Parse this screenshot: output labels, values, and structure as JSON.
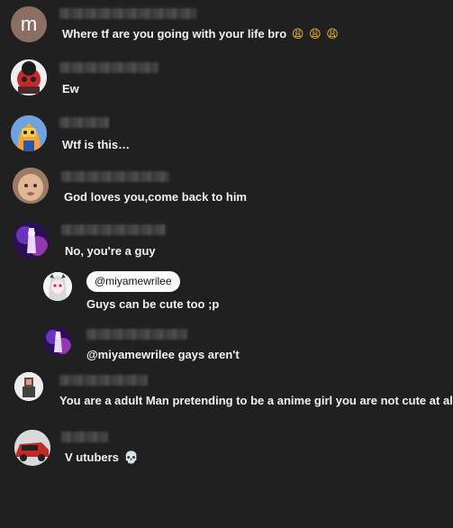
{
  "comments": [
    {
      "avatar_letter": "m",
      "avatar_color": "#8d6e63",
      "text": "Where tf are you going with your life bro",
      "emojis": [
        "😩",
        "😩",
        "😩"
      ]
    },
    {
      "text": "Ew"
    },
    {
      "text": "Wtf is this…"
    },
    {
      "text": "God loves you,come back to him"
    },
    {
      "text": "No, you're a guy",
      "replies": [
        {
          "mention": "@miyamewrilee",
          "text": "Guys can be cute too ;p"
        },
        {
          "text": "@miyamewrilee gays aren't"
        }
      ]
    },
    {
      "text": "You are a adult Man pretending to be a anime girl you are not cute at all"
    },
    {
      "text": "V utubers",
      "emojis": [
        "💀"
      ]
    }
  ],
  "colors": {
    "background": "#202020",
    "text": "#f1f1f1",
    "chip_background": "#ffffff",
    "chip_text": "#0f0f0f"
  }
}
